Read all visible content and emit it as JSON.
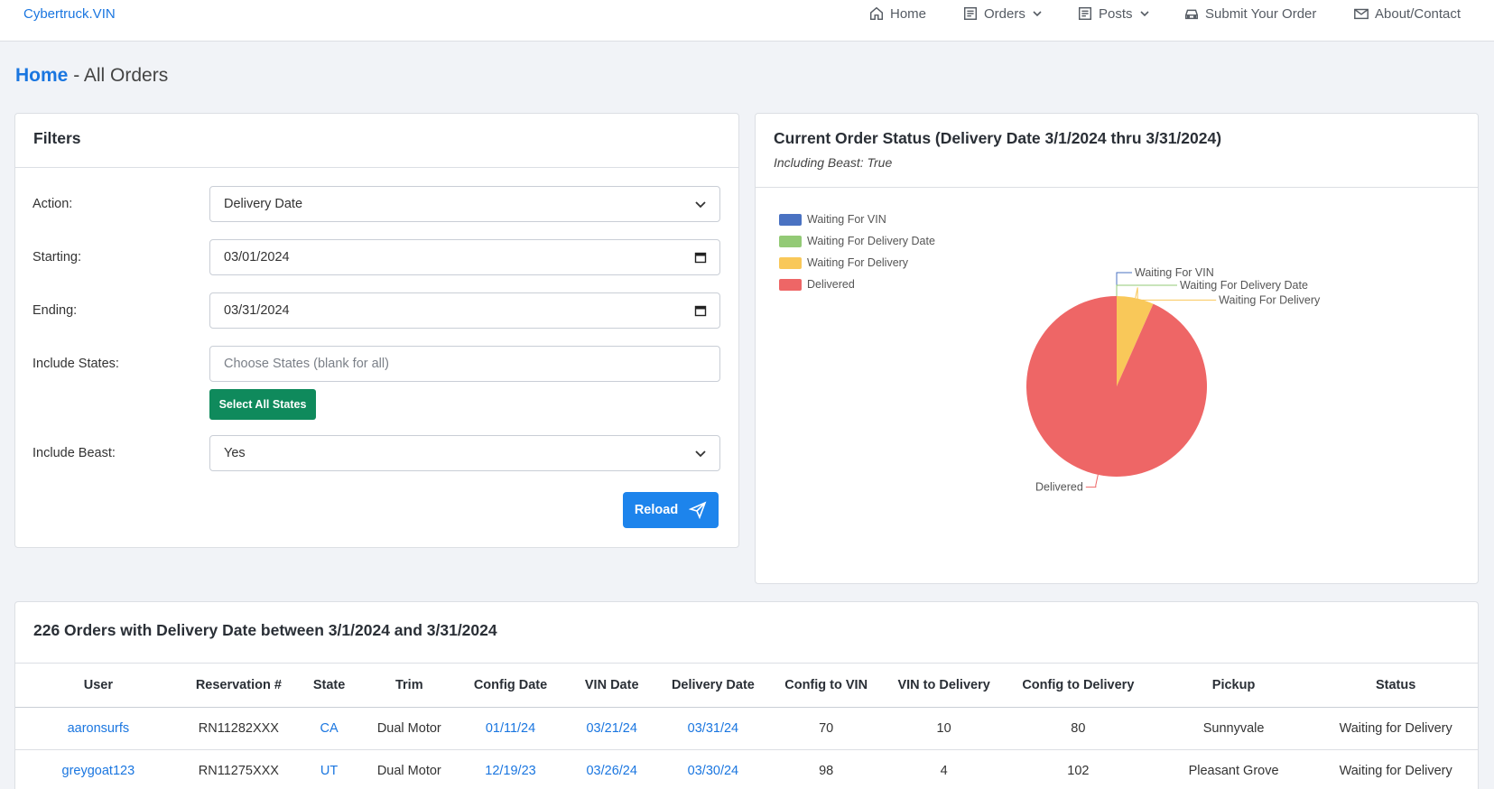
{
  "nav": {
    "brand": "Cybertruck.VIN",
    "items": [
      {
        "label": "Home",
        "icon": "home-icon"
      },
      {
        "label": "Orders",
        "icon": "list-icon",
        "dropdown": true
      },
      {
        "label": "Posts",
        "icon": "list-icon",
        "dropdown": true
      },
      {
        "label": "Submit Your Order",
        "icon": "car-icon"
      },
      {
        "label": "About/Contact",
        "icon": "mail-icon"
      }
    ]
  },
  "breadcrumb": {
    "home": "Home",
    "separator": " - ",
    "current": "All Orders"
  },
  "filters": {
    "title": "Filters",
    "action_label": "Action:",
    "action_value": "Delivery Date",
    "starting_label": "Starting:",
    "starting_value": "03/01/2024",
    "ending_label": "Ending:",
    "ending_value": "03/31/2024",
    "states_label": "Include States:",
    "states_placeholder": "Choose States (blank for all)",
    "select_all_label": "Select All States",
    "beast_label": "Include Beast:",
    "beast_value": "Yes",
    "reload_label": "Reload"
  },
  "status_chart": {
    "title": "Current Order Status (Delivery Date 3/1/2024 thru 3/31/2024)",
    "subtitle": "Including Beast: True"
  },
  "chart_data": {
    "type": "pie",
    "labels": [
      "Waiting For VIN",
      "Waiting For Delivery Date",
      "Waiting For Delivery",
      "Delivered"
    ],
    "values": [
      0,
      0,
      15,
      211
    ],
    "colors": [
      "#4a72c2",
      "#93ca76",
      "#f9c859",
      "#ee6666"
    ],
    "legend_position": "top-left"
  },
  "orders": {
    "title": "226 Orders with Delivery Date between 3/1/2024 and 3/31/2024",
    "columns": [
      "User",
      "Reservation #",
      "State",
      "Trim",
      "Config Date",
      "VIN Date",
      "Delivery Date",
      "Config to VIN",
      "VIN to Delivery",
      "Config to Delivery",
      "Pickup",
      "Status"
    ],
    "rows": [
      [
        "aaronsurfs",
        "RN11282XXX",
        "CA",
        "Dual Motor",
        "01/11/24",
        "03/21/24",
        "03/31/24",
        "70",
        "10",
        "80",
        "Sunnyvale",
        "Waiting for Delivery"
      ],
      [
        "greygoat123",
        "RN11275XXX",
        "UT",
        "Dual Motor",
        "12/19/23",
        "03/26/24",
        "03/30/24",
        "98",
        "4",
        "102",
        "Pleasant Grove",
        "Waiting for Delivery"
      ]
    ]
  }
}
